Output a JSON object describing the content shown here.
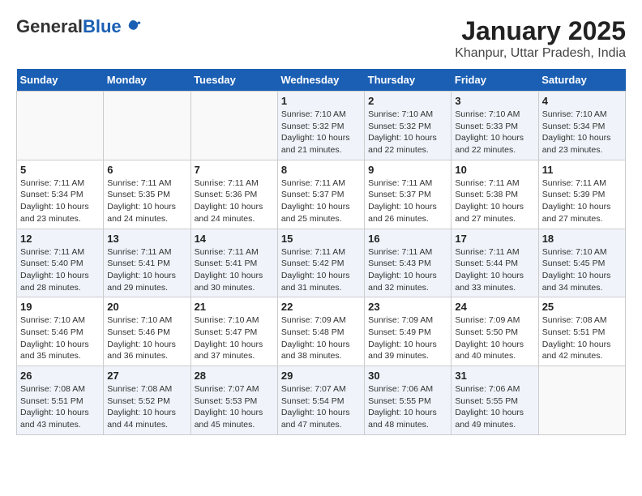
{
  "logo": {
    "general": "General",
    "blue": "Blue"
  },
  "header": {
    "title": "January 2025",
    "subtitle": "Khanpur, Uttar Pradesh, India"
  },
  "weekdays": [
    "Sunday",
    "Monday",
    "Tuesday",
    "Wednesday",
    "Thursday",
    "Friday",
    "Saturday"
  ],
  "weeks": [
    [
      {
        "day": "",
        "sunrise": "",
        "sunset": "",
        "daylight": ""
      },
      {
        "day": "",
        "sunrise": "",
        "sunset": "",
        "daylight": ""
      },
      {
        "day": "",
        "sunrise": "",
        "sunset": "",
        "daylight": ""
      },
      {
        "day": "1",
        "sunrise": "Sunrise: 7:10 AM",
        "sunset": "Sunset: 5:32 PM",
        "daylight": "Daylight: 10 hours and 21 minutes."
      },
      {
        "day": "2",
        "sunrise": "Sunrise: 7:10 AM",
        "sunset": "Sunset: 5:32 PM",
        "daylight": "Daylight: 10 hours and 22 minutes."
      },
      {
        "day": "3",
        "sunrise": "Sunrise: 7:10 AM",
        "sunset": "Sunset: 5:33 PM",
        "daylight": "Daylight: 10 hours and 22 minutes."
      },
      {
        "day": "4",
        "sunrise": "Sunrise: 7:10 AM",
        "sunset": "Sunset: 5:34 PM",
        "daylight": "Daylight: 10 hours and 23 minutes."
      }
    ],
    [
      {
        "day": "5",
        "sunrise": "Sunrise: 7:11 AM",
        "sunset": "Sunset: 5:34 PM",
        "daylight": "Daylight: 10 hours and 23 minutes."
      },
      {
        "day": "6",
        "sunrise": "Sunrise: 7:11 AM",
        "sunset": "Sunset: 5:35 PM",
        "daylight": "Daylight: 10 hours and 24 minutes."
      },
      {
        "day": "7",
        "sunrise": "Sunrise: 7:11 AM",
        "sunset": "Sunset: 5:36 PM",
        "daylight": "Daylight: 10 hours and 24 minutes."
      },
      {
        "day": "8",
        "sunrise": "Sunrise: 7:11 AM",
        "sunset": "Sunset: 5:37 PM",
        "daylight": "Daylight: 10 hours and 25 minutes."
      },
      {
        "day": "9",
        "sunrise": "Sunrise: 7:11 AM",
        "sunset": "Sunset: 5:37 PM",
        "daylight": "Daylight: 10 hours and 26 minutes."
      },
      {
        "day": "10",
        "sunrise": "Sunrise: 7:11 AM",
        "sunset": "Sunset: 5:38 PM",
        "daylight": "Daylight: 10 hours and 27 minutes."
      },
      {
        "day": "11",
        "sunrise": "Sunrise: 7:11 AM",
        "sunset": "Sunset: 5:39 PM",
        "daylight": "Daylight: 10 hours and 27 minutes."
      }
    ],
    [
      {
        "day": "12",
        "sunrise": "Sunrise: 7:11 AM",
        "sunset": "Sunset: 5:40 PM",
        "daylight": "Daylight: 10 hours and 28 minutes."
      },
      {
        "day": "13",
        "sunrise": "Sunrise: 7:11 AM",
        "sunset": "Sunset: 5:41 PM",
        "daylight": "Daylight: 10 hours and 29 minutes."
      },
      {
        "day": "14",
        "sunrise": "Sunrise: 7:11 AM",
        "sunset": "Sunset: 5:41 PM",
        "daylight": "Daylight: 10 hours and 30 minutes."
      },
      {
        "day": "15",
        "sunrise": "Sunrise: 7:11 AM",
        "sunset": "Sunset: 5:42 PM",
        "daylight": "Daylight: 10 hours and 31 minutes."
      },
      {
        "day": "16",
        "sunrise": "Sunrise: 7:11 AM",
        "sunset": "Sunset: 5:43 PM",
        "daylight": "Daylight: 10 hours and 32 minutes."
      },
      {
        "day": "17",
        "sunrise": "Sunrise: 7:11 AM",
        "sunset": "Sunset: 5:44 PM",
        "daylight": "Daylight: 10 hours and 33 minutes."
      },
      {
        "day": "18",
        "sunrise": "Sunrise: 7:10 AM",
        "sunset": "Sunset: 5:45 PM",
        "daylight": "Daylight: 10 hours and 34 minutes."
      }
    ],
    [
      {
        "day": "19",
        "sunrise": "Sunrise: 7:10 AM",
        "sunset": "Sunset: 5:46 PM",
        "daylight": "Daylight: 10 hours and 35 minutes."
      },
      {
        "day": "20",
        "sunrise": "Sunrise: 7:10 AM",
        "sunset": "Sunset: 5:46 PM",
        "daylight": "Daylight: 10 hours and 36 minutes."
      },
      {
        "day": "21",
        "sunrise": "Sunrise: 7:10 AM",
        "sunset": "Sunset: 5:47 PM",
        "daylight": "Daylight: 10 hours and 37 minutes."
      },
      {
        "day": "22",
        "sunrise": "Sunrise: 7:09 AM",
        "sunset": "Sunset: 5:48 PM",
        "daylight": "Daylight: 10 hours and 38 minutes."
      },
      {
        "day": "23",
        "sunrise": "Sunrise: 7:09 AM",
        "sunset": "Sunset: 5:49 PM",
        "daylight": "Daylight: 10 hours and 39 minutes."
      },
      {
        "day": "24",
        "sunrise": "Sunrise: 7:09 AM",
        "sunset": "Sunset: 5:50 PM",
        "daylight": "Daylight: 10 hours and 40 minutes."
      },
      {
        "day": "25",
        "sunrise": "Sunrise: 7:08 AM",
        "sunset": "Sunset: 5:51 PM",
        "daylight": "Daylight: 10 hours and 42 minutes."
      }
    ],
    [
      {
        "day": "26",
        "sunrise": "Sunrise: 7:08 AM",
        "sunset": "Sunset: 5:51 PM",
        "daylight": "Daylight: 10 hours and 43 minutes."
      },
      {
        "day": "27",
        "sunrise": "Sunrise: 7:08 AM",
        "sunset": "Sunset: 5:52 PM",
        "daylight": "Daylight: 10 hours and 44 minutes."
      },
      {
        "day": "28",
        "sunrise": "Sunrise: 7:07 AM",
        "sunset": "Sunset: 5:53 PM",
        "daylight": "Daylight: 10 hours and 45 minutes."
      },
      {
        "day": "29",
        "sunrise": "Sunrise: 7:07 AM",
        "sunset": "Sunset: 5:54 PM",
        "daylight": "Daylight: 10 hours and 47 minutes."
      },
      {
        "day": "30",
        "sunrise": "Sunrise: 7:06 AM",
        "sunset": "Sunset: 5:55 PM",
        "daylight": "Daylight: 10 hours and 48 minutes."
      },
      {
        "day": "31",
        "sunrise": "Sunrise: 7:06 AM",
        "sunset": "Sunset: 5:55 PM",
        "daylight": "Daylight: 10 hours and 49 minutes."
      },
      {
        "day": "",
        "sunrise": "",
        "sunset": "",
        "daylight": ""
      }
    ]
  ]
}
